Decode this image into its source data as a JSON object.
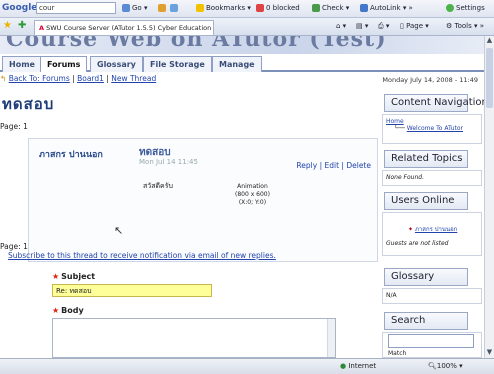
{
  "browser": {
    "search_engine": "Google",
    "search_value": "cour",
    "go_label": "Go",
    "bookmarks_label": "Bookmarks",
    "blocked_label": "0 blocked",
    "check_label": "Check",
    "autolink_label": "AutoLink",
    "settings_label": "Settings",
    "tab_title": "SWU Course Server (ATutor 1.5.5) Cyber Education :...",
    "page_label": "Page",
    "tools_label": "Tools"
  },
  "site": {
    "banner_title": "Course Web on ATutor (Test)",
    "nav_tabs": [
      {
        "label": "Home"
      },
      {
        "label": "Forums"
      },
      {
        "label": "Glossary"
      },
      {
        "label": "File Storage"
      },
      {
        "label": "Manage"
      }
    ],
    "crumbs": {
      "back": "Back To: Forums",
      "board": "Board1",
      "new_thread": "New Thread",
      "sep": "|"
    },
    "date": "Monday July 14, 2008 - 11:49",
    "heading": "ทดสอบ",
    "page_label_top": "Page: 1",
    "page_label_bottom": "Page: 1"
  },
  "post": {
    "author": "ภาสกร ปานนอก",
    "title": "ทดสอบ",
    "date": "Mon Jul 14 11:45",
    "reply": "Reply",
    "edit": "Edit",
    "delete": "Delete",
    "sep": "|",
    "body": "สวัสดีครับ",
    "anim_title": "Animation",
    "anim_size": "(800 x 600)",
    "anim_pos": "(X:0; Y:0)"
  },
  "form": {
    "subscribe_text": "Subscribe to this thread to receive notification via email of new replies.",
    "subject_label": "Subject",
    "subject_value": "Re: ทดสอบ",
    "body_label": "Body",
    "required_mark": "★"
  },
  "side": {
    "content_nav": {
      "title": "Content Navigation",
      "home": "Home",
      "item": "Welcome To ATutor"
    },
    "related": {
      "title": "Related Topics",
      "none": "None Found."
    },
    "users": {
      "title": "Users Online",
      "user": "ภาสกร ปานนอก",
      "guests": "Guests are not listed"
    },
    "glossary": {
      "title": "Glossary",
      "value": "N/A"
    },
    "search": {
      "title": "Search",
      "match": "Match"
    }
  },
  "status": {
    "internet": "Internet",
    "zoom": "100%"
  },
  "colors": {
    "heading": "#1e3c78",
    "link": "#2244aa",
    "subject_bg": "#ffff99",
    "required": "#dd2211"
  }
}
